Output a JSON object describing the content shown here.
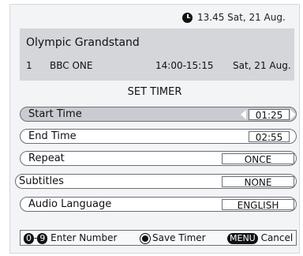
{
  "header": {
    "clock_text": "13.45 Sat, 21 Aug."
  },
  "programme": {
    "title": "Olympic Grandstand",
    "channel_number": "1",
    "channel_name": "BBC ONE",
    "time_range": "14:00-15:15",
    "date": "Sat, 21 Aug."
  },
  "timer": {
    "heading": "SET TIMER",
    "rows": [
      {
        "label": "Start Time",
        "value": "01:25"
      },
      {
        "label": "End Time",
        "value": "02:55"
      },
      {
        "label": "Repeat",
        "value": "ONCE"
      },
      {
        "label": "Subtitles",
        "value": "NONE"
      },
      {
        "label": "Audio Language",
        "value": "ENGLISH"
      }
    ]
  },
  "footer": {
    "key_zero": "0",
    "key_dash": "-",
    "key_nine": "9",
    "enter_number": "Enter Number",
    "save_timer": "Save Timer",
    "menu_key": "MENU",
    "cancel": "Cancel"
  }
}
